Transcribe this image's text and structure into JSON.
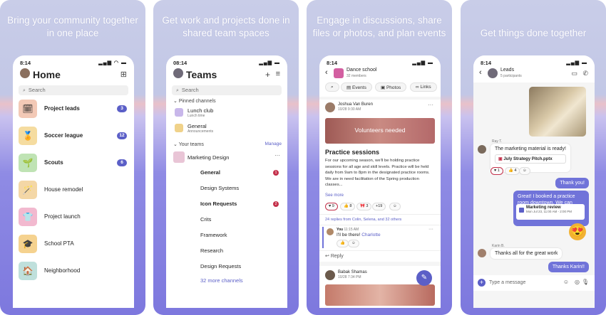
{
  "panels": {
    "home": {
      "tagline": "Bring your community together in one place",
      "time": "8:14",
      "title": "Home",
      "search_placeholder": "Search",
      "items": [
        {
          "label": "Project leads",
          "badge": "3",
          "tile_color": "#f3c9b6",
          "glyph": "🗓"
        },
        {
          "label": "Soccer league",
          "badge": "12",
          "tile_color": "#f5dca0",
          "glyph": "🏅"
        },
        {
          "label": "Scouts",
          "badge": "6",
          "tile_color": "#bfe3b4",
          "glyph": "🌱"
        },
        {
          "label": "House remodel",
          "badge": "",
          "tile_color": "#f4d7a6",
          "glyph": "🪄"
        },
        {
          "label": "Project launch",
          "badge": "",
          "tile_color": "#f2b9cf",
          "glyph": "👕"
        },
        {
          "label": "School PTA",
          "badge": "",
          "tile_color": "#f5d28f",
          "glyph": "🎓"
        },
        {
          "label": "Neighborhood",
          "badge": "",
          "tile_color": "#bfe0dc",
          "glyph": "🏠"
        }
      ]
    },
    "teams": {
      "tagline": "Get work and projects done in shared team spaces",
      "time": "08:14",
      "title": "Teams",
      "search_placeholder": "Search",
      "pinned_label": "Pinned channels",
      "pinned": [
        {
          "name": "Lunch club",
          "sub": "Lunch time"
        },
        {
          "name": "General",
          "sub": "Announcements"
        }
      ],
      "your_teams_label": "Your teams",
      "manage": "Manage",
      "team_name": "Marketing Design",
      "channels": [
        {
          "name": "General",
          "bold": true,
          "badge": "1"
        },
        {
          "name": "Design Systems",
          "bold": false,
          "badge": ""
        },
        {
          "name": "Icon Requests",
          "bold": true,
          "badge": "2"
        },
        {
          "name": "Crits",
          "bold": false,
          "badge": ""
        },
        {
          "name": "Framework",
          "bold": false,
          "badge": ""
        },
        {
          "name": "Research",
          "bold": false,
          "badge": ""
        },
        {
          "name": "Design Requests",
          "bold": false,
          "badge": ""
        }
      ],
      "more_channels": "32 more channels"
    },
    "discuss": {
      "tagline": "Engage in discussions, share files or photos, and plan events",
      "time": "8:14",
      "group_name": "Dance school",
      "group_members": "32 members",
      "tabs": [
        "Events",
        "Photos",
        "Links"
      ],
      "post_author": "Joshua Van Buren",
      "post_time": "10/28 9:30 AM",
      "banner_text": "Volunteers needed",
      "post_title": "Practice sessions",
      "post_body": "For our upcoming season, we'll be holding practice sessions for all age and skill levels. Practice will be held daily from 9am to 8pm in the designated practice rooms. We are in need facilitation of the Spring production classes...",
      "see_more": "See more",
      "reactions": [
        "9",
        "8",
        "3",
        "+19"
      ],
      "replies_text": "24 replies from Colin, Selena, and 32 others",
      "reply_author": "You",
      "reply_time": "11:15 AM",
      "reply_text": "I'll be there!",
      "reply_mention": "Charlotte",
      "reply_placeholder": "Reply",
      "next_author": "Babak Shamas",
      "next_time": "10/28 7:34 PM"
    },
    "chat": {
      "tagline": "Get things done together",
      "time": "8:14",
      "group_name": "Leads",
      "participants": "5 participants",
      "sender1": "Ray T.",
      "msg1": "The marketing material is ready!",
      "file_name": "July Strategy Pitch.pptx",
      "reactions": [
        "1",
        "4"
      ],
      "out1": "Thank you!",
      "out2": "Great! I booked a practice room downtown. We can review.",
      "event_title": "Marketing review",
      "event_time": "Mon Jul 23, 11:00 AM - 2:00 PM",
      "sender2": "Karin B.",
      "msg2": "Thanks all for the great work",
      "out3": "Thanks Karin!!",
      "input_placeholder": "Type a message"
    }
  },
  "colors": {
    "accent": "#5b5fc7",
    "alert": "#c4314b",
    "bubble_out": "#7073d9"
  }
}
